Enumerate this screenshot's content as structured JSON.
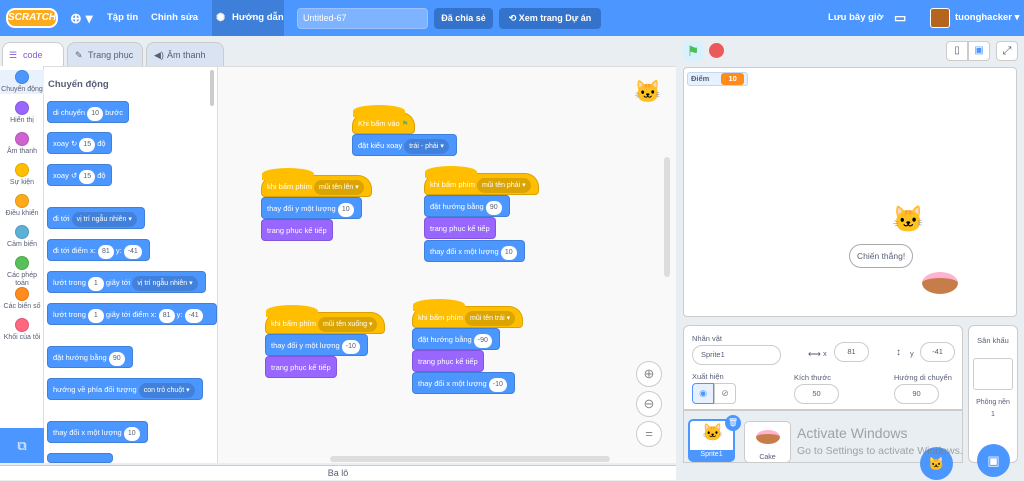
{
  "menu": {
    "logo": "SCRATCH",
    "file": "Tập tin",
    "edit": "Chỉnh sửa",
    "tutorials": "Hướng dẫn",
    "project_title": "Untitled-67",
    "share": "Đã chia sẻ",
    "see_project": "Xem trang Dự án",
    "save_now": "Lưu bây giờ",
    "username": "tuonghacker"
  },
  "tabs": {
    "code": "code",
    "costumes": "Trang phục",
    "sounds": "Âm thanh"
  },
  "categories": [
    {
      "label": "Chuyển động",
      "color": "#4c97ff"
    },
    {
      "label": "Hiển thị",
      "color": "#9966ff"
    },
    {
      "label": "Âm thanh",
      "color": "#cf63cf"
    },
    {
      "label": "Sự kiện",
      "color": "#ffbf00"
    },
    {
      "label": "Điều khiển",
      "color": "#ffab19"
    },
    {
      "label": "Cảm biến",
      "color": "#5cb1d6"
    },
    {
      "label": "Các phép toán",
      "color": "#59c059"
    },
    {
      "label": "Các biến số",
      "color": "#ff8c1a"
    },
    {
      "label": "Khối của tôi",
      "color": "#ff6680"
    }
  ],
  "palette": {
    "heading": "Chuyển động",
    "move": "di chuyển",
    "move_val": "10",
    "steps": "bước",
    "turn_right": "xoay",
    "turn_right_val": "15",
    "degrees": "độ",
    "turn_left": "xoay",
    "turn_left_val": "15",
    "goto": "đi tới",
    "goto_dd": "vị trí ngẫu nhiên",
    "goto_xy": "đi tới điểm x:",
    "goto_x": "81",
    "y_lbl": "y:",
    "goto_y": "-41",
    "glide": "lướt trong",
    "glide_val": "1",
    "glide_secs": "giây tới",
    "glide_dd": "vị trí ngẫu nhiên",
    "glide_xy": "lướt trong",
    "glide_xy_val": "1",
    "glide_xy_secs": "giây tới điểm x:",
    "glide_x": "81",
    "glide_y": "-41",
    "point_dir": "đặt hướng bằng",
    "point_dir_val": "90",
    "point_towards": "hướng về phía đối tượng",
    "point_towards_dd": "con trỏ chuột",
    "change_x": "thay đổi x một lượng",
    "change_x_val": "10"
  },
  "scripts": {
    "flag_hat": "Khi bấm vào",
    "rotation": "đặt kiểu xoay",
    "rotation_dd": "trái - phải",
    "s1_hat": "khi bấm phím",
    "s1_key": "mũi tên lên",
    "s1_change": "thay đổi y một lượng",
    "s1_val": "10",
    "s1_next": "trang phục kế tiếp",
    "s2_hat": "khi bấm phím",
    "s2_key": "mũi tên phải",
    "s2_dir": "đặt hướng bằng",
    "s2_dir_val": "90",
    "s2_next": "trang phục kế tiếp",
    "s2_change": "thay đổi x một lượng",
    "s2_val": "10",
    "s3_hat": "khi bấm phím",
    "s3_key": "mũi tên xuống",
    "s3_change": "thay đổi y một lượng",
    "s3_val": "-10",
    "s3_next": "trang phục kế tiếp",
    "s4_hat": "khi bấm phím",
    "s4_key": "mũi tên trái",
    "s4_dir": "đặt hướng bằng",
    "s4_dir_val": "-90",
    "s4_next": "trang phục kế tiếp",
    "s4_change": "thay đổi x một lượng",
    "s4_val": "-10"
  },
  "stage": {
    "var_name": "Điểm",
    "var_val": "10",
    "speech": "Chiến thắng!"
  },
  "sprite": {
    "label": "Nhân vật",
    "name": "Sprite1",
    "x_lbl": "x",
    "x": "81",
    "y_lbl": "y",
    "y": "-41",
    "show": "Xuất hiện",
    "size_lbl": "Kích thước",
    "size": "50",
    "dir_lbl": "Hướng di chuyển",
    "dir": "90"
  },
  "sprites": [
    {
      "name": "Sprite1"
    },
    {
      "name": "Cake"
    }
  ],
  "stage_panel": {
    "title": "Sân khấu",
    "backdrops": "Phông nền",
    "count": "1"
  },
  "watermark": {
    "line1": "Activate Windows",
    "line2": "Go to Settings to activate Windows."
  },
  "backpack": "Ba lô",
  "colors": {
    "accent": "#4c97ff",
    "motion": "#4c97ff",
    "looks": "#9966ff",
    "events": "#ffbf00"
  }
}
